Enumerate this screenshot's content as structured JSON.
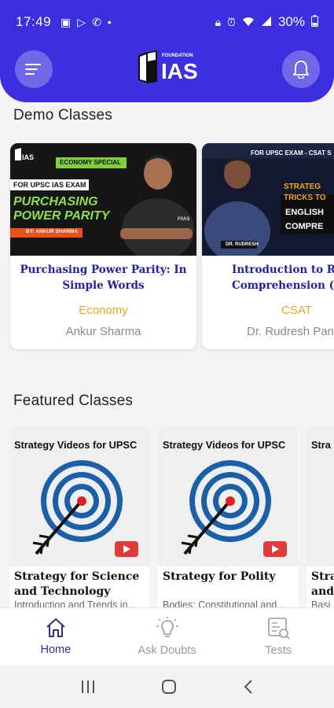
{
  "status_bar": {
    "time": "17:49",
    "battery": "30%"
  },
  "header": {
    "logo_text": "IAS",
    "logo_small": "FOUNDATION"
  },
  "demo": {
    "section_title": "Demo Classes",
    "cards": [
      {
        "thumb_badge": "ECONOMY SPECIAL",
        "thumb_exam": "FOR UPSC  IAS EXAM",
        "thumb_headline1": "PURCHASING",
        "thumb_headline2": "POWER PARITY",
        "thumb_by": "BY: ANKUR SHARMA",
        "title": "Purchasing Power Parity: In Simple Words",
        "subject": "Economy",
        "teacher": "Ankur Sharma"
      },
      {
        "thumb_exam": "FOR UPSC EXAM - CSAT S",
        "thumb_line1": "STRATEG",
        "thumb_line2": "TRICKS TO",
        "thumb_line3": "ENGLISH",
        "thumb_line4": "COMPRE",
        "thumb_name": "DR. RUDRESH",
        "title": "Introduction to Rea Comprehension (",
        "subject": "CSAT",
        "teacher": "Dr. Rudresh Panc"
      }
    ]
  },
  "featured": {
    "section_title": "Featured Classes",
    "cards": [
      {
        "thumb_heading": "Strategy Videos for UPSC",
        "title": "Strategy for Science and Technology",
        "subtitle": "Introduction and Trends in..."
      },
      {
        "thumb_heading": "Strategy Videos for UPSC",
        "title": "Strategy for Polity",
        "subtitle": "Bodies: Constitutional and..."
      },
      {
        "thumb_heading": "Stra",
        "title": "Stra and",
        "subtitle": "Basi"
      }
    ]
  },
  "bottom_nav": [
    {
      "label": "Home",
      "icon": "home-icon",
      "active": true
    },
    {
      "label": "Ask Doubts",
      "icon": "lightbulb-icon",
      "active": false
    },
    {
      "label": "Tests",
      "icon": "test-icon",
      "active": false
    }
  ],
  "colors": {
    "primary": "#3b2fe0",
    "accent": "#e2a91a",
    "title_blue": "#2020a8"
  }
}
